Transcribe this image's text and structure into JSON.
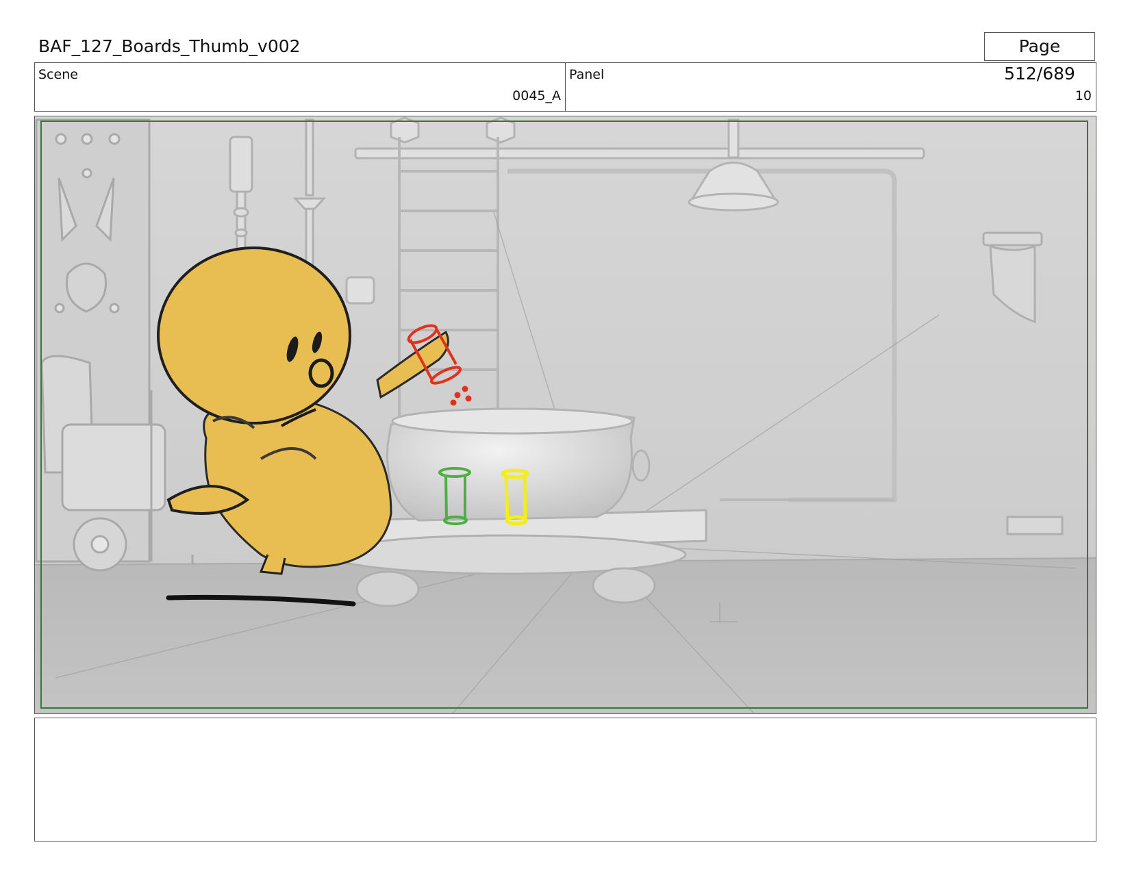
{
  "document": {
    "title": "BAF_127_Boards_Thumb_v002",
    "page_label": "Page 512/689"
  },
  "info": {
    "scene_label": "Scene",
    "scene_value": "0045_A",
    "panel_label": "Panel",
    "panel_value": "10"
  },
  "artwork": {
    "safe_frame_color": "#2f7d2f",
    "character_color": "#e8bd52",
    "red_shaker_color": "#e0321c",
    "green_shaker_color": "#4fae43",
    "yellow_shaker_color": "#f3ee1a",
    "background_color": "#d3d3d3"
  },
  "notes": {
    "text": ""
  }
}
